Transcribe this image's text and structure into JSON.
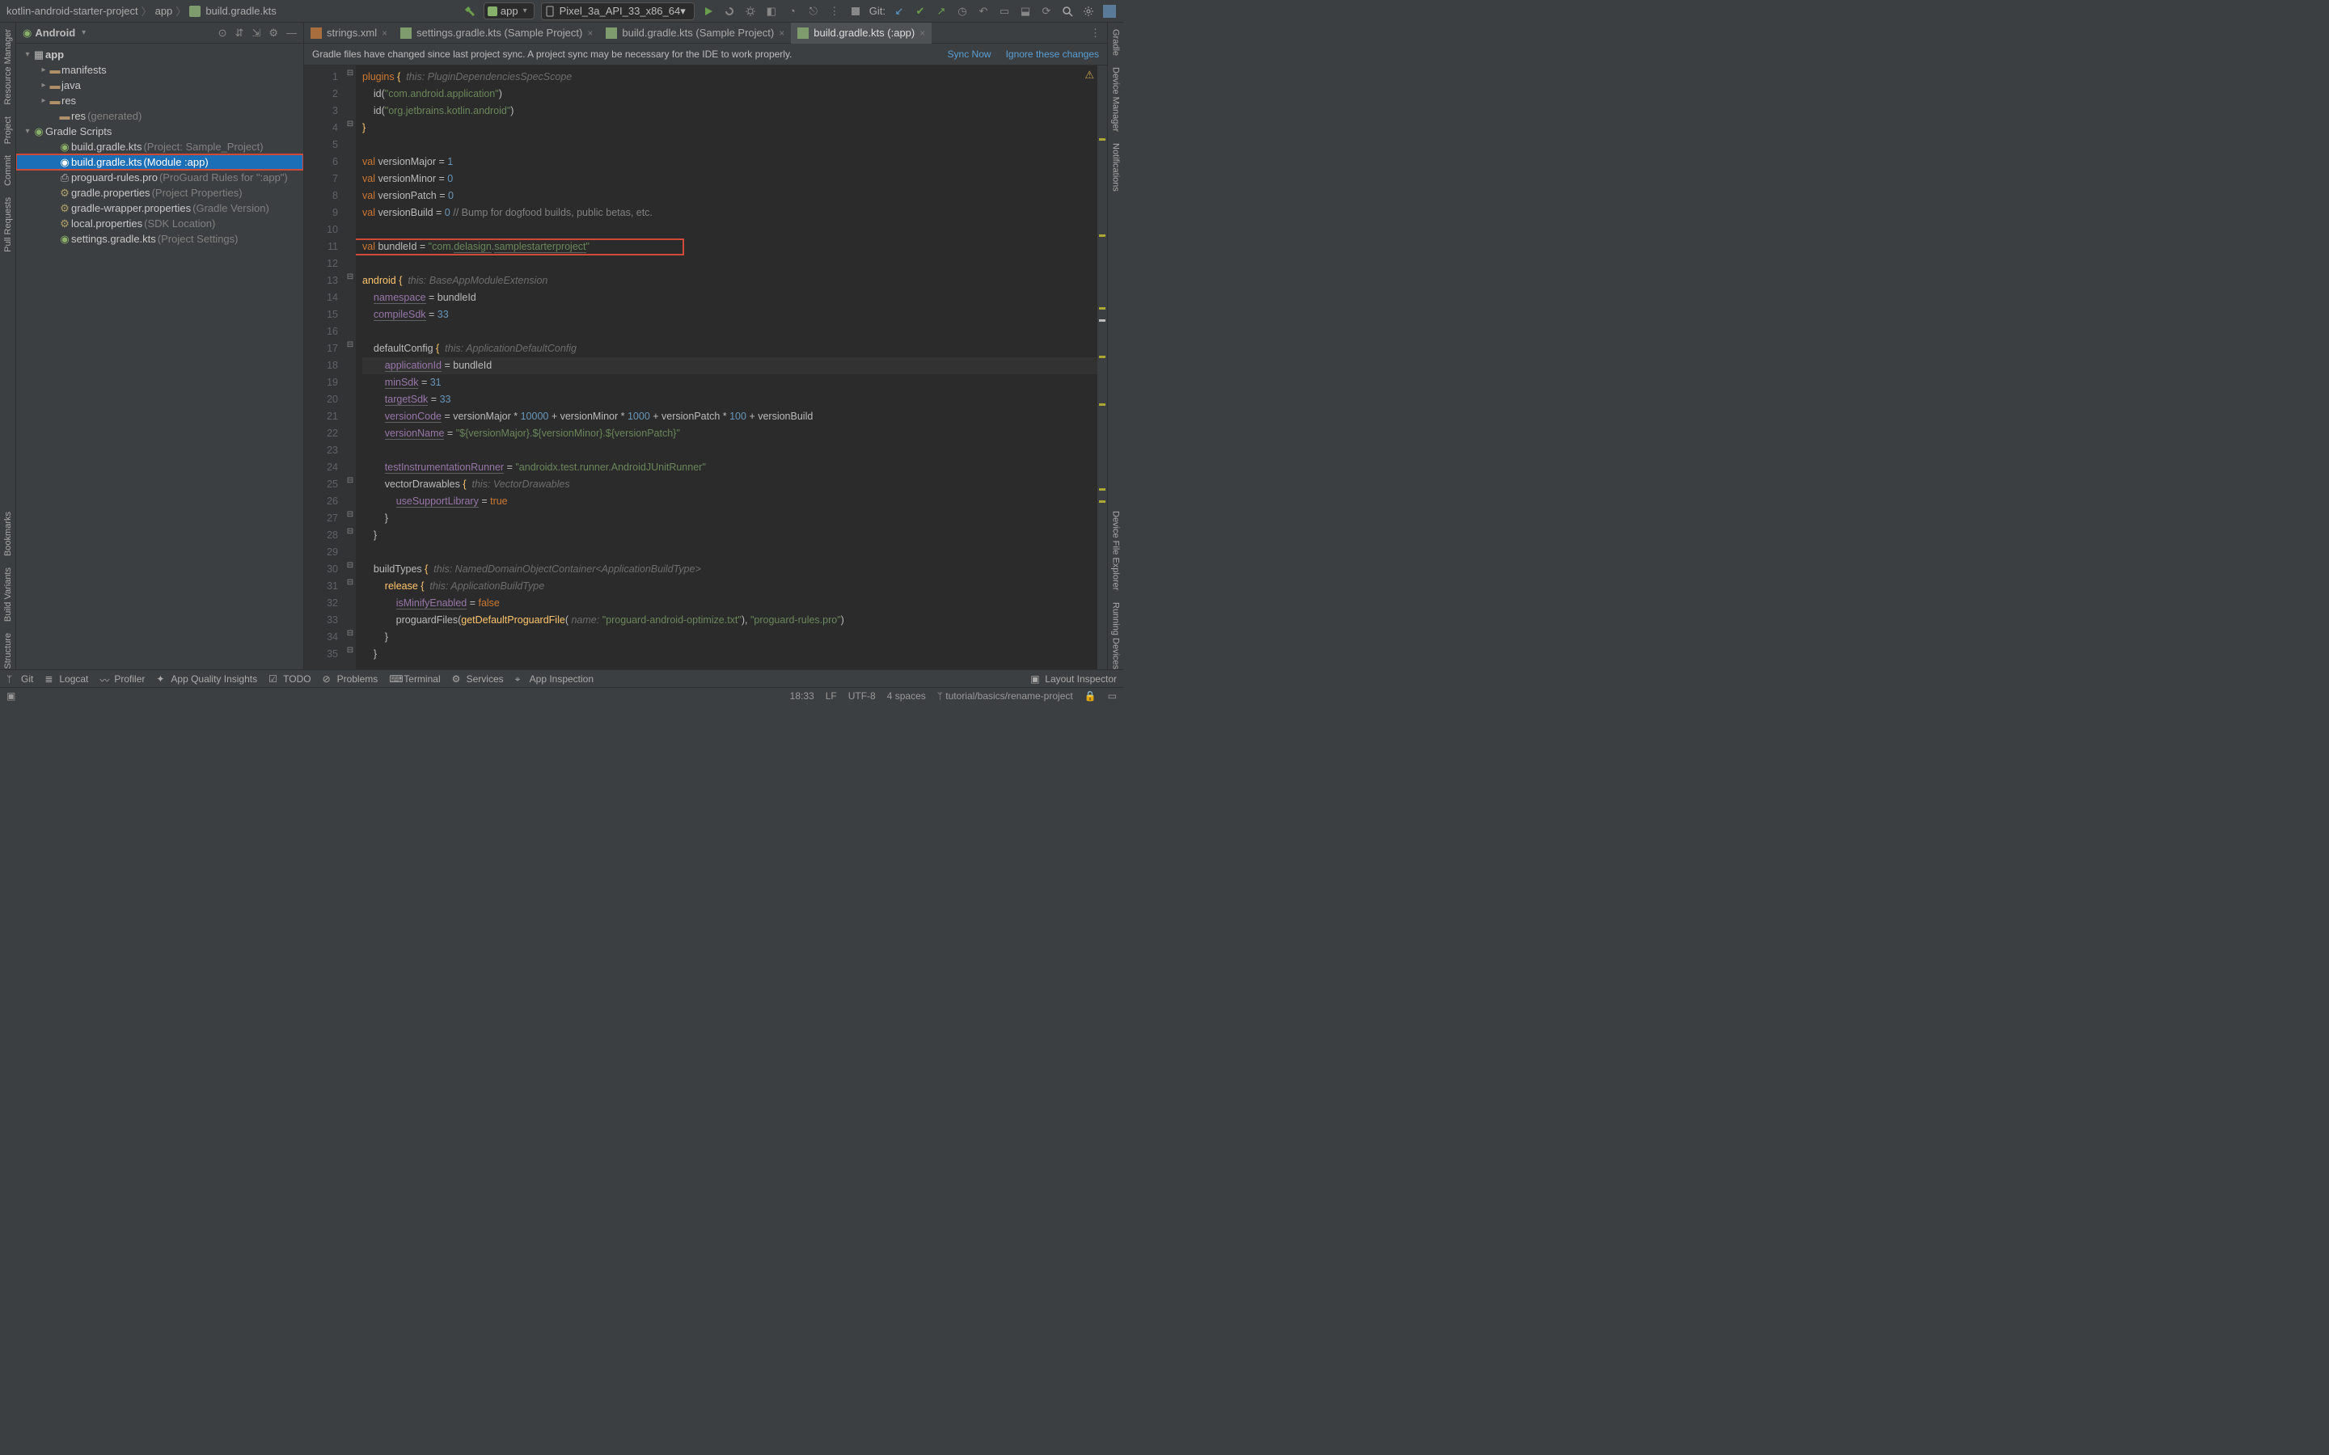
{
  "breadcrumbs": [
    "kotlin-android-starter-project",
    "app",
    "build.gradle.kts"
  ],
  "run_config": "app",
  "device": "Pixel_3a_API_33_x86_64",
  "git_label": "Git:",
  "panel": {
    "title": "Android",
    "root": "app",
    "children": [
      "manifests",
      "java",
      "res"
    ],
    "res_gen": [
      "res",
      "(generated)"
    ],
    "gradle_scripts": "Gradle Scripts",
    "scripts": [
      {
        "name": "build.gradle.kts",
        "suffix": "(Project: Sample_Project)"
      },
      {
        "name": "build.gradle.kts",
        "suffix": "(Module :app)"
      },
      {
        "name": "proguard-rules.pro",
        "suffix": "(ProGuard Rules for \":app\")"
      },
      {
        "name": "gradle.properties",
        "suffix": "(Project Properties)"
      },
      {
        "name": "gradle-wrapper.properties",
        "suffix": "(Gradle Version)"
      },
      {
        "name": "local.properties",
        "suffix": "(SDK Location)"
      },
      {
        "name": "settings.gradle.kts",
        "suffix": "(Project Settings)"
      }
    ]
  },
  "tabs": [
    {
      "label": "strings.xml"
    },
    {
      "label": "settings.gradle.kts (Sample Project)"
    },
    {
      "label": "build.gradle.kts (Sample Project)"
    },
    {
      "label": "build.gradle.kts (:app)"
    }
  ],
  "notif": {
    "msg": "Gradle files have changed since last project sync. A project sync may be necessary for the IDE to work properly.",
    "sync": "Sync Now",
    "ignore": "Ignore these changes"
  },
  "code_lines": [
    {
      "n": 1,
      "html": "<span class='kw'>plugins</span> <span class='fn'>{</span>  <span class='hi'>this: PluginDependenciesSpecScope</span>"
    },
    {
      "n": 2,
      "html": "    id(<span class='str'>\"com.android.application\"</span>)"
    },
    {
      "n": 3,
      "html": "    id(<span class='str'>\"org.jetbrains.kotlin.android\"</span>)"
    },
    {
      "n": 4,
      "html": "<span class='fn'>}</span>"
    },
    {
      "n": 5,
      "html": ""
    },
    {
      "n": 6,
      "html": "<span class='kw'>val</span> versionMajor = <span class='num'>1</span>"
    },
    {
      "n": 7,
      "html": "<span class='kw'>val</span> versionMinor = <span class='num'>0</span>"
    },
    {
      "n": 8,
      "html": "<span class='kw'>val</span> versionPatch = <span class='num'>0</span>"
    },
    {
      "n": 9,
      "html": "<span class='kw'>val</span> versionBuild = <span class='num'>0</span> <span class='cm'>// Bump for dogfood builds, public betas, etc.</span>"
    },
    {
      "n": 10,
      "html": ""
    },
    {
      "n": 11,
      "html": "<span class='kw'>val</span> bundleId = <span class='str'>\"com.<span class='ul'>delasign</span>.<span class='ul'>samplestarterproject</span>\"</span>",
      "boxed": true
    },
    {
      "n": 12,
      "html": ""
    },
    {
      "n": 13,
      "html": "<span class='fn'>android</span> <span class='fn'>{</span>  <span class='hi'>this: BaseAppModuleExtension</span>"
    },
    {
      "n": 14,
      "html": "    <span class='prop ul'>namespace</span> = bundleId"
    },
    {
      "n": 15,
      "html": "    <span class='prop ul'>compileSdk</span> = <span class='num'>33</span>"
    },
    {
      "n": 16,
      "html": ""
    },
    {
      "n": 17,
      "html": "    defaultConfig <span class='fn'>{</span>  <span class='hi'>this: ApplicationDefaultConfig</span>"
    },
    {
      "n": 18,
      "html": "        <span class='prop ul'>applicationId</span> = bundleId",
      "current": true
    },
    {
      "n": 19,
      "html": "        <span class='prop ul'>minSdk</span> = <span class='num'>31</span>"
    },
    {
      "n": 20,
      "html": "        <span class='prop ul'>targetSdk</span> = <span class='num'>33</span>"
    },
    {
      "n": 21,
      "html": "        <span class='prop ul'>versionCode</span> = versionMajor * <span class='num'>10000</span> + versionMinor * <span class='num'>1000</span> + versionPatch * <span class='num'>100</span> + versionBuild"
    },
    {
      "n": 22,
      "html": "        <span class='prop ul'>versionName</span> = <span class='str'>\"${versionMajor}.${versionMinor}.${versionPatch}\"</span>"
    },
    {
      "n": 23,
      "html": ""
    },
    {
      "n": 24,
      "html": "        <span class='prop ul'>testInstrumentationRunner</span> = <span class='str'>\"androidx.test.runner.AndroidJUnitRunner\"</span>"
    },
    {
      "n": 25,
      "html": "        vectorDrawables <span class='fn'>{</span>  <span class='hi'>this: VectorDrawables</span>"
    },
    {
      "n": 26,
      "html": "            <span class='prop ul'>useSupportLibrary</span> = <span class='bool'>true</span>"
    },
    {
      "n": 27,
      "html": "        }"
    },
    {
      "n": 28,
      "html": "    }"
    },
    {
      "n": 29,
      "html": ""
    },
    {
      "n": 30,
      "html": "    buildTypes <span class='fn'>{</span>  <span class='hi'>this: NamedDomainObjectContainer&lt;ApplicationBuildType&gt;</span>"
    },
    {
      "n": 31,
      "html": "        <span class='fn'>release</span> <span class='fn'>{</span>  <span class='hi'>this: ApplicationBuildType</span>"
    },
    {
      "n": 32,
      "html": "            <span class='prop ul'>isMinifyEnabled</span> = <span class='bool'>false</span>"
    },
    {
      "n": 33,
      "html": "            proguardFiles(<span class='fn'>getDefaultProguardFile</span>( <span class='hi'>name:</span> <span class='str'>\"proguard-android-optimize.txt\"</span>), <span class='str'>\"proguard-rules.pro\"</span>)"
    },
    {
      "n": 34,
      "html": "        }"
    },
    {
      "n": 35,
      "html": "    }"
    }
  ],
  "bottom": {
    "git": "Git",
    "logcat": "Logcat",
    "profiler": "Profiler",
    "aq": "App Quality Insights",
    "todo": "TODO",
    "problems": "Problems",
    "terminal": "Terminal",
    "services": "Services",
    "appinsp": "App Inspection",
    "layout": "Layout Inspector"
  },
  "left_stripe": [
    "Resource Manager",
    "Project",
    "Commit",
    "Pull Requests",
    "Bookmarks",
    "Build Variants",
    "Structure"
  ],
  "right_stripe": [
    "Gradle",
    "Device Manager",
    "Notifications",
    "Device File Explorer",
    "Running Devices"
  ],
  "status": {
    "pos": "18:33",
    "lf": "LF",
    "enc": "UTF-8",
    "indent": "4 spaces",
    "branch": "tutorial/basics/rename-project"
  }
}
